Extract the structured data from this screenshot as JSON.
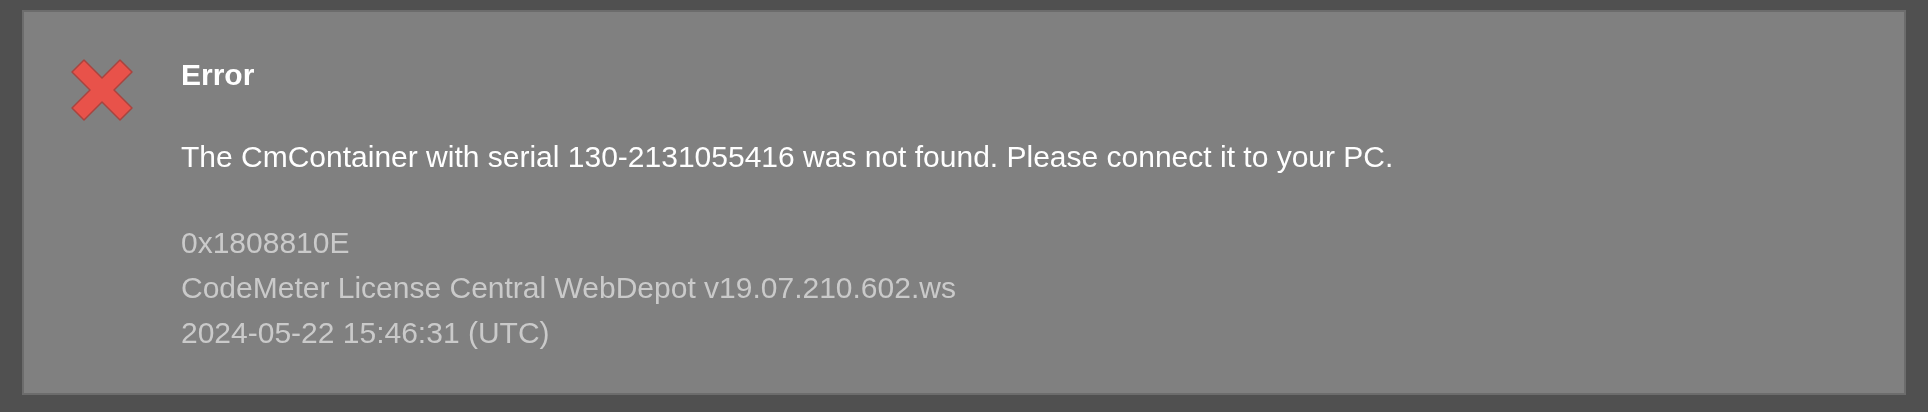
{
  "dialog": {
    "title": "Error",
    "message": "The CmContainer with serial 130-2131055416 was not found. Please connect it to your PC.",
    "details": [
      "0x1808810E",
      "CodeMeter License Central WebDepot v19.07.210.602.ws",
      "2024-05-22 15:46:31 (UTC)"
    ]
  }
}
